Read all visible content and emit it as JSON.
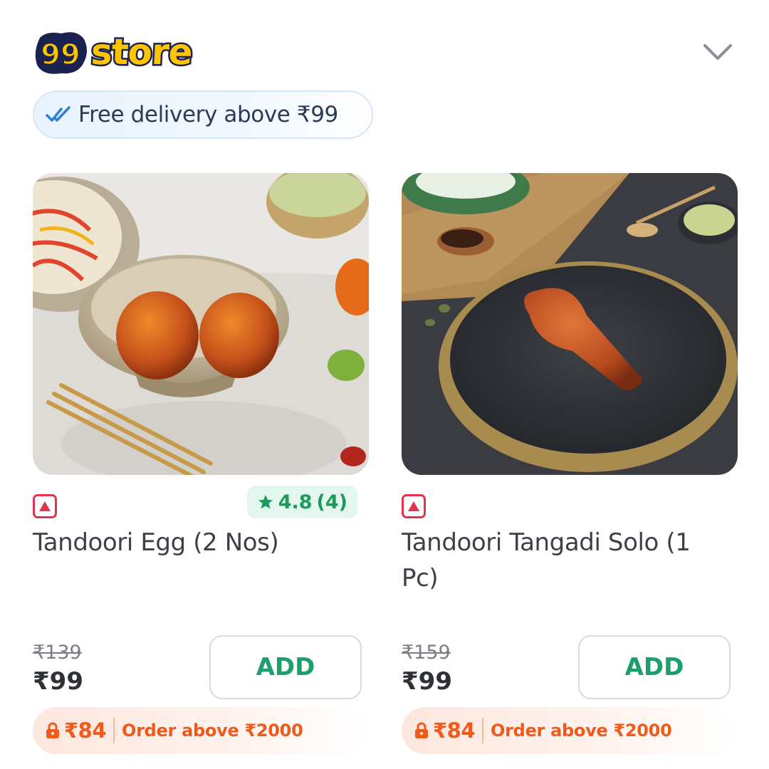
{
  "header": {
    "logo_number": "99",
    "logo_text": "store",
    "collapse_icon": "chevron-down-icon"
  },
  "banner": {
    "text": "Free delivery above ₹99",
    "icon": "double-check-icon"
  },
  "products": [
    {
      "name": "Tandoori Egg (2 Nos)",
      "veg_type": "non-veg",
      "rating": "4.8",
      "rating_count": "(4)",
      "mrp": "₹139",
      "price": "₹99",
      "add_label": "ADD",
      "offer_price": "₹84",
      "offer_text": "Order above ₹2000"
    },
    {
      "name": "Tandoori Tangadi Solo (1 Pc)",
      "veg_type": "non-veg",
      "mrp": "₹159",
      "price": "₹99",
      "add_label": "ADD",
      "offer_price": "₹84",
      "offer_text": "Order above ₹2000"
    }
  ],
  "colors": {
    "accent_green": "#1ba06b",
    "offer_orange": "#f05a1a",
    "nonveg_red": "#e0344f",
    "logo_yellow": "#ffc400",
    "logo_navy": "#1a2250"
  }
}
